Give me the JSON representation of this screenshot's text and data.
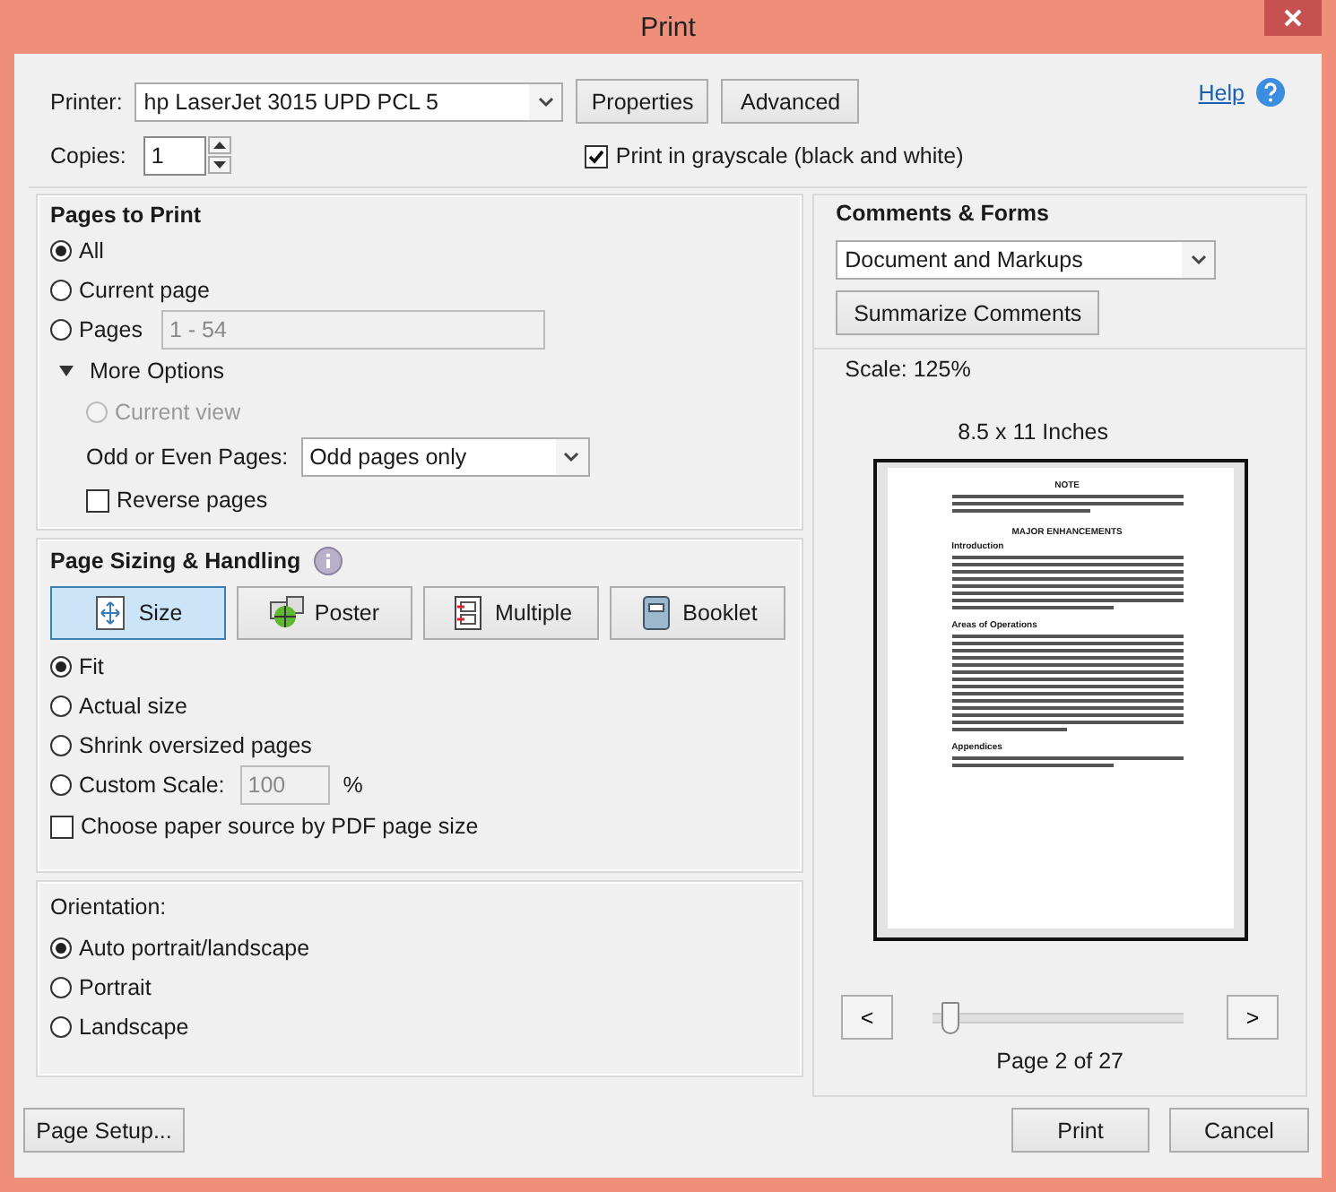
{
  "window": {
    "title": "Print"
  },
  "printer": {
    "label": "Printer:",
    "value": "hp LaserJet 3015 UPD PCL 5",
    "buttons": [
      "Properties",
      "Advanced"
    ],
    "help": "Help"
  },
  "copies": {
    "label": "Copies:",
    "value": "1"
  },
  "grayscale": {
    "label": "Print in grayscale (black and white)",
    "checked": true
  },
  "pages_to_print": {
    "title": "Pages to Print",
    "options": [
      {
        "label": "All",
        "selected": true
      },
      {
        "label": "Current page",
        "selected": false
      },
      {
        "label": "Pages",
        "selected": false,
        "field_value": "1 - 54"
      }
    ],
    "more_options": {
      "label": "More Options",
      "expanded": true
    },
    "current_view": {
      "label": "Current view",
      "selected": false,
      "disabled": true
    },
    "odd_even": {
      "label": "Odd or Even Pages:",
      "value": "Odd pages only"
    },
    "reverse": {
      "label": "Reverse pages",
      "checked": false
    }
  },
  "page_sizing": {
    "title": "Page Sizing & Handling",
    "modes": [
      {
        "label": "Size",
        "kind": "size",
        "selected": true
      },
      {
        "label": "Poster",
        "kind": "poster",
        "selected": false
      },
      {
        "label": "Multiple",
        "kind": "multiple",
        "selected": false
      },
      {
        "label": "Booklet",
        "kind": "booklet",
        "selected": false
      }
    ],
    "options": [
      {
        "label": "Fit",
        "selected": true
      },
      {
        "label": "Actual size",
        "selected": false
      },
      {
        "label": "Shrink oversized pages",
        "selected": false
      },
      {
        "label": "Custom Scale:",
        "selected": false,
        "field_value": "100",
        "unit": "%"
      }
    ],
    "paper_source": {
      "label": "Choose paper source by PDF page size",
      "checked": false
    }
  },
  "orientation": {
    "title": "Orientation:",
    "options": [
      {
        "label": "Auto portrait/landscape",
        "selected": true
      },
      {
        "label": "Portrait",
        "selected": false
      },
      {
        "label": "Landscape",
        "selected": false
      }
    ]
  },
  "comments_forms": {
    "title": "Comments & Forms",
    "value": "Document and Markups",
    "button": "Summarize Comments"
  },
  "preview": {
    "scale": "Scale: 125%",
    "paper_size": "8.5 x 11 Inches",
    "page_headings": [
      "NOTE",
      "MAJOR ENHANCEMENTS",
      "Introduction",
      "Areas of Operations",
      "Appendices"
    ],
    "prev": "<",
    "next": ">",
    "level": 0.07,
    "page_label": "Page 2 of 27"
  },
  "buttons": {
    "page_setup": "Page Setup...",
    "print": "Print",
    "cancel": "Cancel"
  }
}
